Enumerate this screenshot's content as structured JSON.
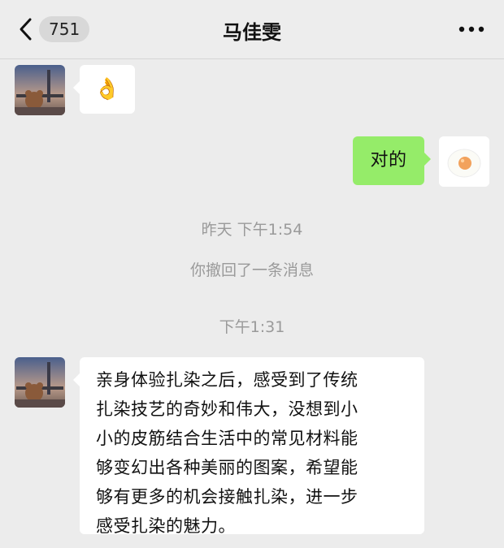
{
  "header": {
    "badge_count": "751",
    "title": "马佳雯",
    "more_label": "•••"
  },
  "messages": {
    "first_emoji": "👌",
    "reply_text": "对的",
    "timestamp_1": "昨天 下午1:54",
    "recall_notice": "你撤回了一条消息",
    "timestamp_2": "下午1:31",
    "long_text": "亲身体验扎染之后，感受到了传统\n扎染技艺的奇妙和伟大，没想到小\n小的皮筋结合生活中的常见材料能\n够变幻出各种美丽的图案，希望能\n够有更多的机会接触扎染，进一步\n感受扎染的魅力。"
  },
  "colors": {
    "background": "#ececec",
    "sent_bubble": "#95ec69",
    "received_bubble": "#ffffff",
    "system_text": "#9a9a9a"
  }
}
